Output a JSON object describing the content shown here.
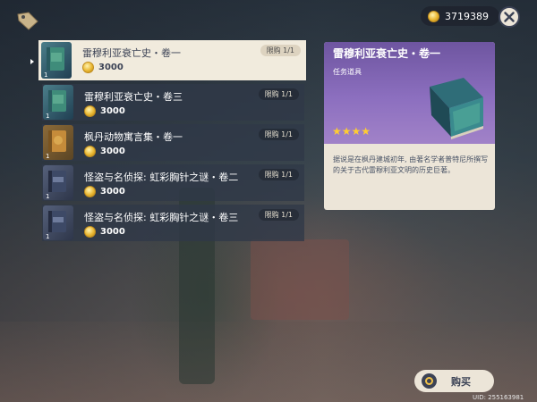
{
  "currency": {
    "amount": "3719389",
    "icon": "mora-coin-icon"
  },
  "items": [
    {
      "name": "雷穆利亚衰亡史・卷一",
      "price": "3000",
      "limit": "限购 1/1",
      "count": "1",
      "cover": "blue-book"
    },
    {
      "name": "雷穆利亚衰亡史・卷三",
      "price": "3000",
      "limit": "限购 1/1",
      "count": "1",
      "cover": "blue-book"
    },
    {
      "name": "枫丹动物寓言集・卷一",
      "price": "3000",
      "limit": "限购 1/1",
      "count": "1",
      "cover": "orange-book"
    },
    {
      "name": "怪盗与名侦探: 虹彩胸针之谜・卷二",
      "price": "3000",
      "limit": "限购 1/1",
      "count": "1",
      "cover": "dark-book"
    },
    {
      "name": "怪盗与名侦探: 虹彩胸针之谜・卷三",
      "price": "3000",
      "limit": "限购 1/1",
      "count": "1",
      "cover": "dark-book"
    }
  ],
  "detail": {
    "title": "雷穆利亚衰亡史・卷一",
    "type": "任务道具",
    "stars": "★★★★",
    "rarity_color": "#8c6fbf",
    "description": "据说是在枫丹建城初年, 由著名学者普特尼所撰写的关于古代雷穆利亚文明的历史巨著。"
  },
  "buy_label": "购买",
  "uid": "UID: 255163981"
}
